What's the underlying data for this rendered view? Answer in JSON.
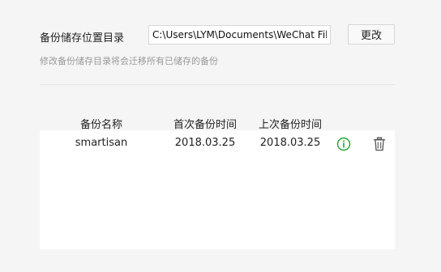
{
  "storage": {
    "label": "备份储存位置目录",
    "path_value": "C:\\Users\\LYM\\Documents\\WeChat Files",
    "change_button": "更改",
    "hint": "修改备份储存目录将会迁移所有已储存的备份"
  },
  "table": {
    "columns": [
      "备份名称",
      "首次备份时间",
      "上次备份时间"
    ],
    "rows": [
      {
        "name": "smartisan",
        "first_backup": "2018.03.25",
        "last_backup": "2018.03.25"
      }
    ]
  },
  "icons": {
    "info": "info-icon",
    "delete": "trash-icon"
  },
  "colors": {
    "info_green": "#22a330",
    "icon_gray": "#555555"
  }
}
